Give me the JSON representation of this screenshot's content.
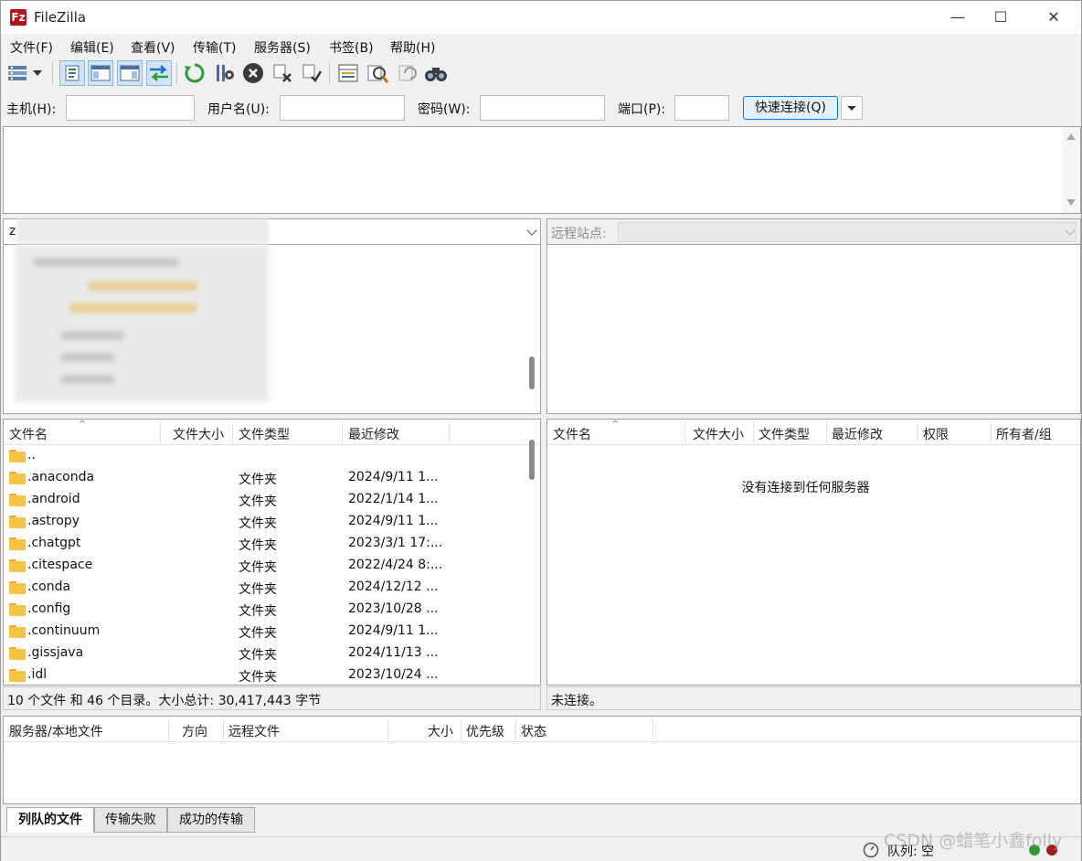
{
  "window": {
    "title": "FileZilla",
    "app_icon_text": "Fz",
    "controls": {
      "minimize": "—",
      "maximize": "☐",
      "close": "✕"
    }
  },
  "menu": [
    "文件(F)",
    "编辑(E)",
    "查看(V)",
    "传输(T)",
    "服务器(S)",
    "书签(B)",
    "帮助(H)"
  ],
  "toolbar": {
    "icons": [
      "site-manager-icon",
      "dropdown-arrow-icon",
      "toggle-message-log-icon",
      "toggle-local-tree-icon",
      "toggle-remote-tree-icon",
      "toggle-transfer-queue-icon",
      "refresh-icon",
      "process-queue-icon",
      "cancel-icon",
      "disconnect-icon",
      "reconnect-icon",
      "directory-listing-filter-icon",
      "compare-directories-icon",
      "sync-browsing-icon",
      "search-remote-files-icon"
    ]
  },
  "quickconnect": {
    "host_label": "主机(H):",
    "user_label": "用户名(U):",
    "pass_label": "密码(W):",
    "port_label": "端口(P):",
    "host_value": "",
    "user_value": "",
    "pass_value": "",
    "port_value": "",
    "connect_button": "快速连接(Q)"
  },
  "local": {
    "path_prefix": "z",
    "columns": [
      "文件名",
      "文件大小",
      "文件类型",
      "最近修改"
    ],
    "files": [
      {
        "name": "..",
        "size": "",
        "type": "",
        "modified": ""
      },
      {
        "name": ".anaconda",
        "size": "",
        "type": "文件夹",
        "modified": "2024/9/11 1..."
      },
      {
        "name": ".android",
        "size": "",
        "type": "文件夹",
        "modified": "2022/1/14 1..."
      },
      {
        "name": ".astropy",
        "size": "",
        "type": "文件夹",
        "modified": "2024/9/11 1..."
      },
      {
        "name": ".chatgpt",
        "size": "",
        "type": "文件夹",
        "modified": "2023/3/1 17:..."
      },
      {
        "name": ".citespace",
        "size": "",
        "type": "文件夹",
        "modified": "2022/4/24 8:..."
      },
      {
        "name": ".conda",
        "size": "",
        "type": "文件夹",
        "modified": "2024/12/12 ..."
      },
      {
        "name": ".config",
        "size": "",
        "type": "文件夹",
        "modified": "2023/10/28 ..."
      },
      {
        "name": ".continuum",
        "size": "",
        "type": "文件夹",
        "modified": "2024/9/11 1..."
      },
      {
        "name": ".gissjava",
        "size": "",
        "type": "文件夹",
        "modified": "2024/11/13 ..."
      },
      {
        "name": ".idl",
        "size": "",
        "type": "文件夹",
        "modified": "2023/10/24 ..."
      }
    ],
    "status": "10 个文件 和 46 个目录。大小总计: 30,417,443 字节"
  },
  "remote": {
    "site_label": "远程站点:",
    "site_value": "",
    "columns": [
      "文件名",
      "文件大小",
      "文件类型",
      "最近修改",
      "权限",
      "所有者/组"
    ],
    "empty_message": "没有连接到任何服务器",
    "status": "未连接。"
  },
  "queue": {
    "columns": [
      "服务器/本地文件",
      "方向",
      "远程文件",
      "大小",
      "优先级",
      "状态"
    ],
    "tabs": [
      "列队的文件",
      "传输失败",
      "成功的传输"
    ],
    "status": "队列: 空"
  },
  "watermark": "CSDN @蜡笔小鑫folly",
  "colors": {
    "folder": "#f6c445",
    "accent": "#0078d7",
    "brand": "#b5121b"
  }
}
